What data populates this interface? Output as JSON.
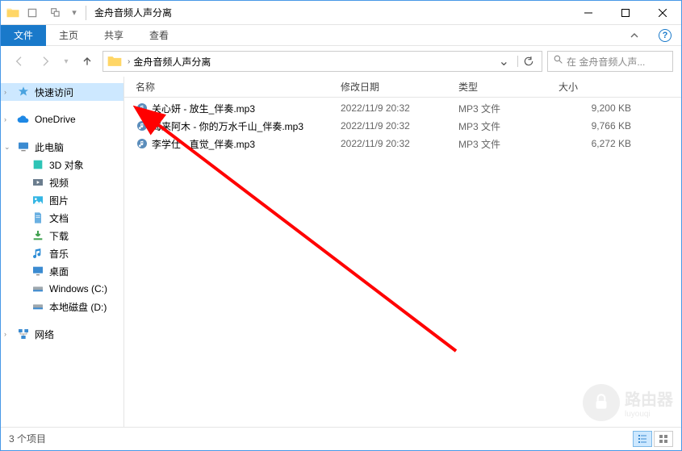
{
  "window": {
    "title": "金舟音频人声分离"
  },
  "ribbon": {
    "file": "文件",
    "tabs": [
      "主页",
      "共享",
      "查看"
    ]
  },
  "breadcrumb": {
    "current": "金舟音频人声分离",
    "search_placeholder": "在 金舟音频人声..."
  },
  "sidebar": {
    "quick_access": "快速访问",
    "onedrive": "OneDrive",
    "this_pc": "此电脑",
    "items": [
      {
        "label": "3D 对象"
      },
      {
        "label": "视频"
      },
      {
        "label": "图片"
      },
      {
        "label": "文档"
      },
      {
        "label": "下载"
      },
      {
        "label": "音乐"
      },
      {
        "label": "桌面"
      },
      {
        "label": "Windows (C:)"
      },
      {
        "label": "本地磁盘 (D:)"
      }
    ],
    "network": "网络"
  },
  "columns": {
    "name": "名称",
    "date": "修改日期",
    "type": "类型",
    "size": "大小"
  },
  "files": [
    {
      "name": "关心妍 - 放生_伴奏.mp3",
      "date": "2022/11/9 20:32",
      "type": "MP3 文件",
      "size": "9,200 KB"
    },
    {
      "name": "海来阿木 - 你的万水千山_伴奏.mp3",
      "date": "2022/11/9 20:32",
      "type": "MP3 文件",
      "size": "9,766 KB"
    },
    {
      "name": "李学仕 - 直觉_伴奏.mp3",
      "date": "2022/11/9 20:32",
      "type": "MP3 文件",
      "size": "6,272 KB"
    }
  ],
  "status": {
    "count_text": "3 个项目"
  },
  "watermark": {
    "text": "路由器",
    "sub": "luyouqi"
  }
}
